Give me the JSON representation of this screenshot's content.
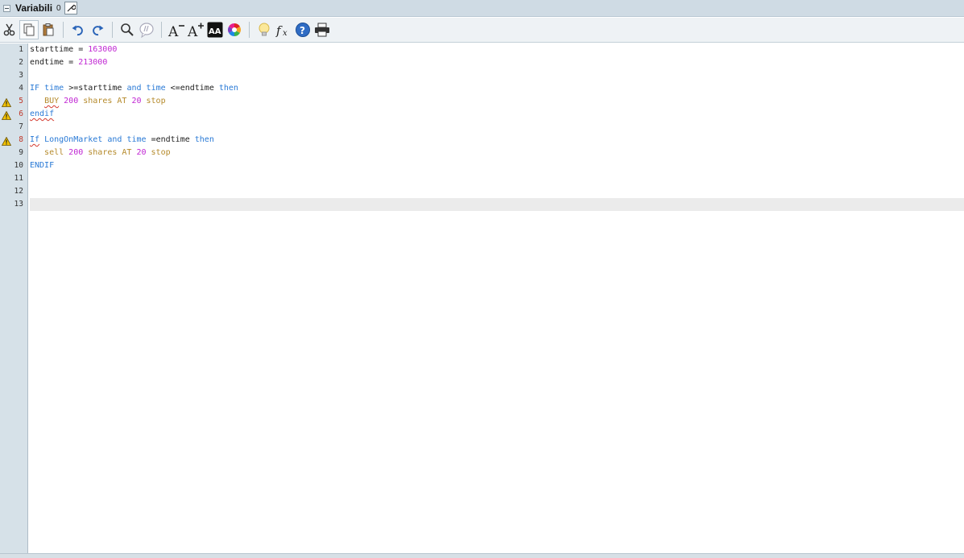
{
  "panel": {
    "title": "Variabili",
    "count": "0"
  },
  "toolbar": {
    "items": [
      "cut-icon",
      "copy-icon",
      "paste-icon",
      "undo-icon",
      "redo-icon",
      "search-icon",
      "comment-icon",
      "decrease-font-icon",
      "increase-font-icon",
      "font-style-icon",
      "color-wheel-icon",
      "bulb-icon",
      "function-icon",
      "help-icon",
      "print-icon"
    ]
  },
  "lines": [
    {
      "num": "1"
    },
    {
      "num": "2"
    },
    {
      "num": "3"
    },
    {
      "num": "4"
    },
    {
      "num": "5",
      "warning": true
    },
    {
      "num": "6",
      "warning": true
    },
    {
      "num": "7"
    },
    {
      "num": "8",
      "warning": true
    },
    {
      "num": "9"
    },
    {
      "num": "10"
    },
    {
      "num": "11"
    },
    {
      "num": "12"
    },
    {
      "num": "13"
    }
  ],
  "code": {
    "l1": {
      "a": "starttime",
      "b": " = ",
      "c": "163000"
    },
    "l2": {
      "a": "endtime",
      "b": " = ",
      "c": "213000"
    },
    "l4": {
      "a": "IF",
      "b": " ",
      "c": "time",
      "d": " >=starttime ",
      "e": "and",
      "f": " ",
      "g": "time",
      "h": " <=endtime ",
      "i": "then"
    },
    "l5": {
      "a": "   ",
      "b": "BUY",
      "c": " ",
      "d": "200",
      "e": " shares AT ",
      "f": "20",
      "g": " stop"
    },
    "l6": {
      "a": "endif"
    },
    "l8": {
      "a": "If",
      "b": " ",
      "c": "LongOnMarket",
      "d": " ",
      "e": "and",
      "f": " ",
      "g": "time",
      "h": " =endtime ",
      "i": "then"
    },
    "l9": {
      "a": "   sell ",
      "b": "200",
      "c": " shares AT ",
      "d": "20",
      "e": " stop"
    },
    "l10": {
      "a": "ENDIF"
    }
  },
  "colors": {
    "keyword": "#2a7ad6",
    "number": "#c026d3",
    "order": "#b58a2b",
    "gutter": "#d6e1e8"
  }
}
